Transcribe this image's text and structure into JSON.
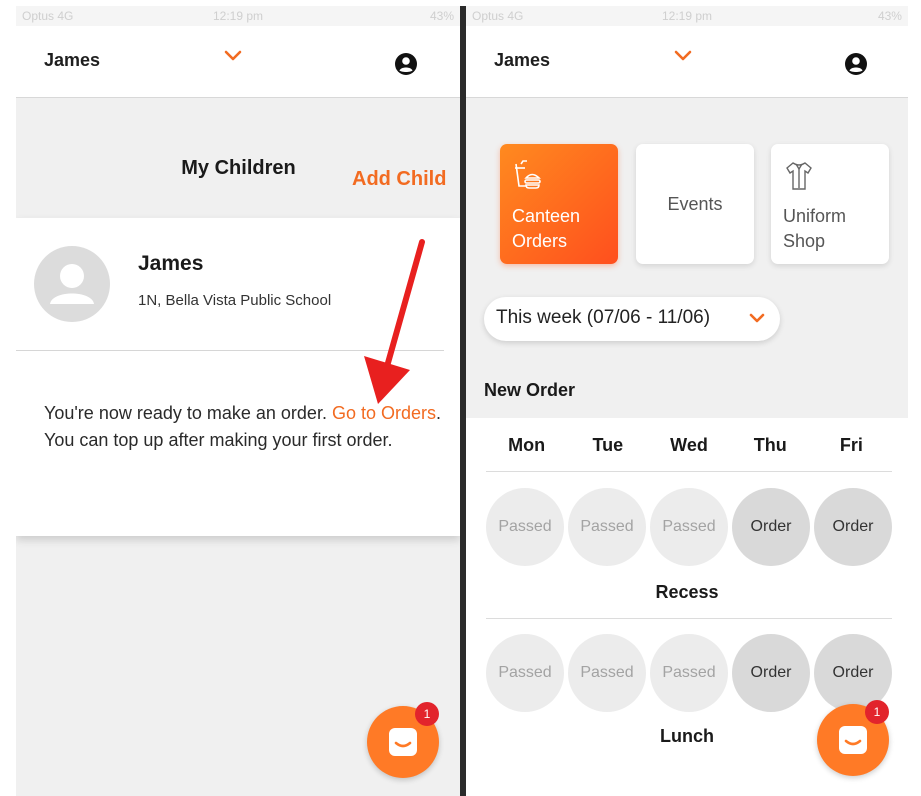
{
  "statusbar": {
    "carrier": "Optus 4G",
    "time": "12:19 pm",
    "battery": "43%"
  },
  "left": {
    "header": {
      "child_name": "James"
    },
    "title": "My Children",
    "add_child": "Add Child",
    "card": {
      "name": "James",
      "school": "1N, Bella Vista Public School",
      "msg_line1": "You're now ready to make an order. ",
      "link": "Go to Orders",
      "msg_dot": ".",
      "msg_line2": "You can top up after making your first order."
    },
    "chat_badge": "1"
  },
  "right": {
    "header": {
      "child_name": "James"
    },
    "tiles": [
      {
        "label": "Canteen Orders",
        "active": true
      },
      {
        "label": "Events",
        "active": false
      },
      {
        "label": "Uniform Shop",
        "active": false
      }
    ],
    "week_selector": "This week (07/06 - 11/06)",
    "new_order": "New Order",
    "days": [
      "Mon",
      "Tue",
      "Wed",
      "Thu",
      "Fri"
    ],
    "recess": {
      "label": "Recess",
      "slots": [
        "Passed",
        "Passed",
        "Passed",
        "Order",
        "Order"
      ]
    },
    "lunch": {
      "label": "Lunch",
      "slots": [
        "Passed",
        "Passed",
        "Passed",
        "Order",
        "Order"
      ]
    },
    "chat_badge": "1"
  },
  "colors": {
    "accent": "#f26b21",
    "badge": "#e2242c"
  },
  "icons": [
    "chevron-down-icon",
    "user-circle-icon",
    "avatar-placeholder-icon",
    "canteen-icon",
    "shirt-icon",
    "chat-icon",
    "arrow-annotation"
  ]
}
